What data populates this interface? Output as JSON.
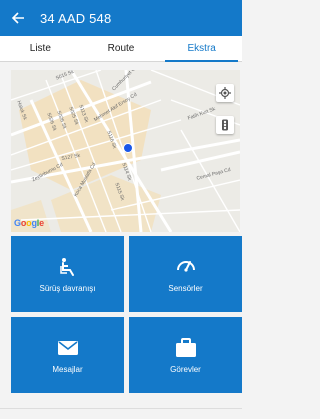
{
  "header": {
    "title": "34 AAD 548"
  },
  "tabs": [
    {
      "label": "Liste"
    },
    {
      "label": "Route"
    },
    {
      "label": "Ekstra"
    }
  ],
  "map": {
    "streets": [
      "S015 Sk",
      "Cumhuriyet Cd",
      "Mehmet Akif Ersoy Cd",
      "S026 Sk",
      "S026 Sk",
      "S025 Sk",
      "S113 Sk",
      "S127 Sk",
      "S114 Sk",
      "S116 Sk",
      "Cemal Paşa Cd",
      "Fatih Kurt Sk",
      "Zeytinburnu Cd",
      "Koca Mustafa Cd",
      "S115 Sk",
      "Haluk Sk"
    ],
    "google_logo": "Google"
  },
  "tiles": [
    {
      "label": "Sürüş davranışı",
      "icon": "driver-seat-icon"
    },
    {
      "label": "Sensörler",
      "icon": "gauge-icon"
    },
    {
      "label": "Mesajlar",
      "icon": "envelope-icon"
    },
    {
      "label": "Görevler",
      "icon": "briefcase-icon"
    }
  ],
  "colors": {
    "primary": "#1479c9",
    "background": "#f3f3f3",
    "marker": "#1a57e8"
  }
}
